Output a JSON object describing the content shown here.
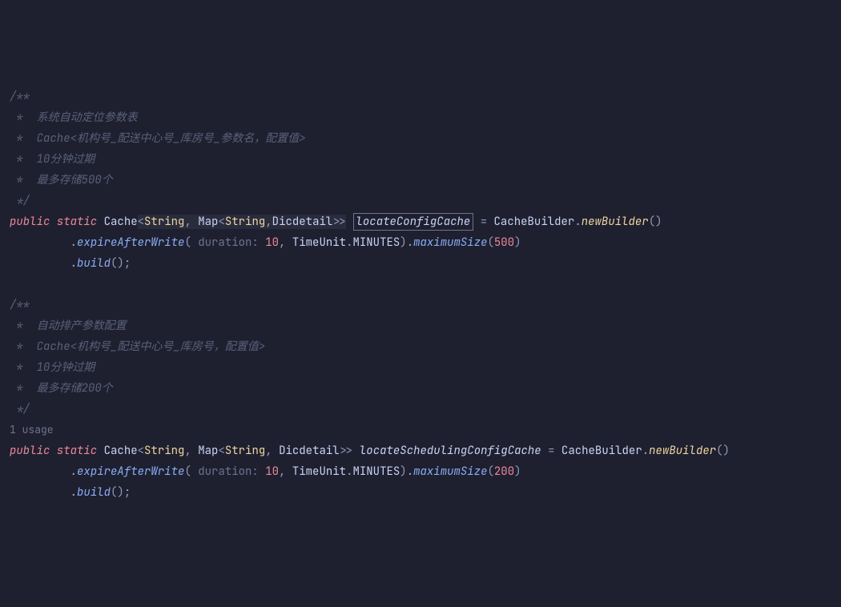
{
  "code": {
    "doc1": {
      "open": "/**",
      "l1": " *  系统自动定位参数表",
      "l2": " *  Cache<机构号_配送中心号_库房号_参数名，配置值>",
      "l3": " *  10分钟过期",
      "l4": " *  最多存储500个",
      "close": " */"
    },
    "decl1": {
      "kw_public": "public",
      "kw_static": "static",
      "type_cache": "Cache",
      "lt": "<",
      "str1": "String",
      "comma1": ", ",
      "map": "Map",
      "lt2": "<",
      "str2": "String",
      "comma2": ",",
      "dic": "Dicdetail",
      "gt2": ">",
      "gt": ">",
      "varname": "locateConfigCache",
      "eq": " = ",
      "builder": "CacheBuilder",
      "dot1": ".",
      "newBuilder": "newBuilder",
      "paren1": "()"
    },
    "chain1": {
      "indent": "         ",
      "dot2": ".",
      "expire": "expireAfterWrite",
      "lparen": "(",
      "hint_dur": " duration: ",
      "num10": "10",
      "comma": ", ",
      "timeunit": "TimeUnit",
      "dot3": ".",
      "minutes": "MINUTES",
      "rparen": ")",
      "dot4": ".",
      "maxsize": "maximumSize",
      "lparen2": "(",
      "num500": "500",
      "rparen2": ")"
    },
    "chain1b": {
      "indent": "         ",
      "dot": ".",
      "build": "build",
      "paren": "()",
      "semi": ";"
    },
    "doc2": {
      "open": "/**",
      "l1": " *  自动排产参数配置",
      "l2": " *  Cache<机构号_配送中心号_库房号，配置值>",
      "l3": " *  10分钟过期",
      "l4": " *  最多存储200个",
      "close": " */"
    },
    "usage": "1 usage",
    "decl2": {
      "kw_public": "public",
      "kw_static": "static",
      "type_cache": "Cache",
      "lt": "<",
      "str1": "String",
      "comma1": ", ",
      "map": "Map",
      "lt2": "<",
      "str2": "String",
      "comma2": ", ",
      "dic": "Dicdetail",
      "gt2": ">>",
      "varname": "locateSchedulingConfigCache",
      "eq": " = ",
      "builder": "CacheBuilder",
      "dot1": ".",
      "newBuilder": "newBuilder",
      "paren1": "()"
    },
    "chain2": {
      "indent": "         ",
      "dot2": ".",
      "expire": "expireAfterWrite",
      "lparen": "(",
      "hint_dur": " duration: ",
      "num10": "10",
      "comma": ", ",
      "timeunit": "TimeUnit",
      "dot3": ".",
      "minutes": "MINUTES",
      "rparen": ")",
      "dot4": ".",
      "maxsize": "maximumSize",
      "lparen2": "(",
      "num200": "200",
      "rparen2": ")"
    },
    "chain2b": {
      "indent": "         ",
      "dot": ".",
      "build": "build",
      "paren": "()",
      "semi": ";"
    }
  }
}
